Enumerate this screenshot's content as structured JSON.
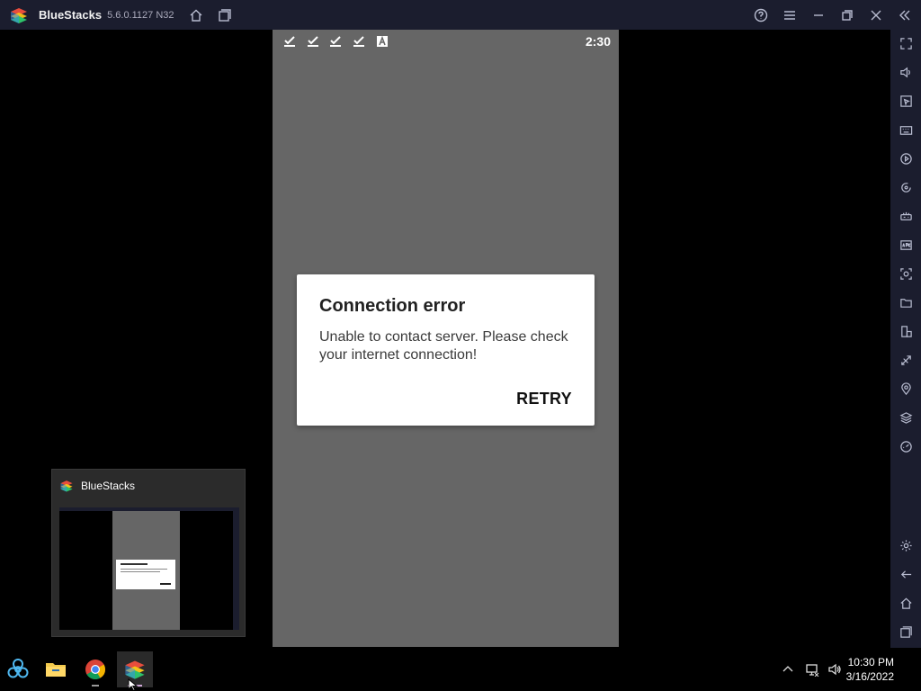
{
  "titlebar": {
    "app_name": "BlueStacks",
    "version": "5.6.0.1127 N32",
    "buttons": [
      "home-icon",
      "multi-instance-icon",
      "help-icon",
      "menu-icon",
      "minimize-icon",
      "restore-icon",
      "close-icon",
      "collapse-sidebar-icon"
    ]
  },
  "sidebar": {
    "items": [
      "fullscreen-icon",
      "volume-icon",
      "pointer-icon",
      "keyboard-icon",
      "macro-icon",
      "rotate-sync-icon",
      "game-controls-icon",
      "apk-install-icon",
      "screenshot-icon",
      "folder-icon",
      "multi-screen-icon",
      "eco-mode-icon",
      "location-icon",
      "layers-icon",
      "performance-icon",
      "settings-icon",
      "back-icon",
      "home-icon",
      "recents-icon"
    ]
  },
  "android": {
    "status_time": "2:30",
    "status_icons": [
      "check-icon",
      "check-icon",
      "check-icon",
      "check-icon",
      "a-badge-icon"
    ],
    "background_color": "#666666"
  },
  "dialog": {
    "title": "Connection error",
    "message": "Unable to contact server. Please check your internet connection!",
    "retry_label": "RETRY"
  },
  "preview": {
    "title": "BlueStacks"
  },
  "taskbar": {
    "apps": [
      "biohazard-icon",
      "file-explorer-icon",
      "chrome-icon",
      "bluestacks-icon"
    ],
    "tray": [
      "chevron-up-icon",
      "network-icon",
      "volume-icon"
    ],
    "time": "10:30 PM",
    "date": "3/16/2022"
  },
  "colors": {
    "chrome_bar": "#1b1d2e",
    "icon_stroke": "#b8bcd0",
    "android_bg": "#666666"
  }
}
